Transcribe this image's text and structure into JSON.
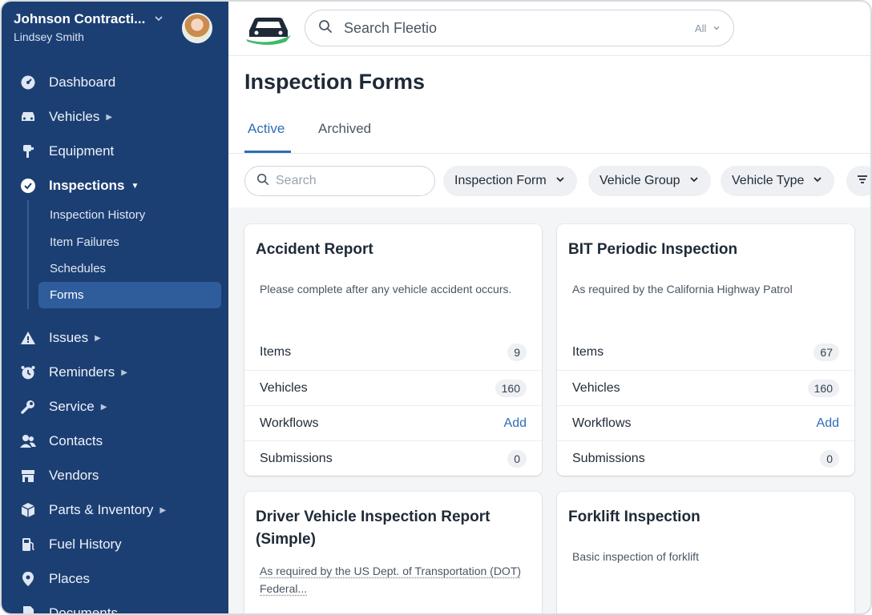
{
  "account": {
    "company": "Johnson Contracti...",
    "user": "Lindsey Smith"
  },
  "sidebar": {
    "items": [
      {
        "label": "Dashboard"
      },
      {
        "label": "Vehicles"
      },
      {
        "label": "Equipment"
      },
      {
        "label": "Inspections"
      },
      {
        "label": "Issues"
      },
      {
        "label": "Reminders"
      },
      {
        "label": "Service"
      },
      {
        "label": "Contacts"
      },
      {
        "label": "Vendors"
      },
      {
        "label": "Parts & Inventory"
      },
      {
        "label": "Fuel History"
      },
      {
        "label": "Places"
      },
      {
        "label": "Documents"
      }
    ],
    "inspections_sub": [
      {
        "label": "Inspection History"
      },
      {
        "label": "Item Failures"
      },
      {
        "label": "Schedules"
      },
      {
        "label": "Forms"
      }
    ]
  },
  "topbar": {
    "search_placeholder": "Search Fleetio",
    "search_scope": "All"
  },
  "page": {
    "title": "Inspection Forms"
  },
  "tabs": [
    {
      "label": "Active"
    },
    {
      "label": "Archived"
    }
  ],
  "filters": {
    "search_placeholder": "Search",
    "chips": [
      {
        "label": "Inspection Form"
      },
      {
        "label": "Vehicle Group"
      },
      {
        "label": "Vehicle Type"
      }
    ]
  },
  "labels": {
    "items": "Items",
    "vehicles": "Vehicles",
    "workflows": "Workflows",
    "submissions": "Submissions",
    "add": "Add"
  },
  "cards": [
    {
      "title": "Accident Report",
      "description": "Please complete after any vehicle accident occurs.",
      "items": "9",
      "vehicles": "160",
      "submissions": "0"
    },
    {
      "title": "BIT Periodic Inspection",
      "description": "As required by the California Highway Patrol",
      "items": "67",
      "vehicles": "160",
      "submissions": "0"
    },
    {
      "title": "Driver Vehicle Inspection Report (Simple)",
      "description": "As required by the US Dept. of Transportation (DOT) Federal..."
    },
    {
      "title": "Forklift Inspection",
      "description": "Basic inspection of forklift"
    }
  ],
  "colors": {
    "sidebar_bg": "#1c3f73",
    "accent": "#2e6db4",
    "logo_green": "#3fb96b"
  }
}
